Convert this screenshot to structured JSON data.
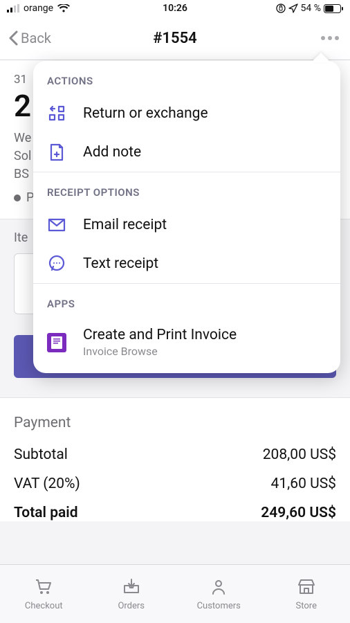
{
  "status_bar": {
    "carrier": "orange",
    "time": "10:26",
    "battery_pct": "54 %"
  },
  "nav": {
    "back_label": "Back",
    "title": "#1554"
  },
  "order": {
    "date": "31",
    "amount_prefix": "2",
    "addr1": "We",
    "addr2": "Sol",
    "addr3": "BS",
    "status_label": "P"
  },
  "items": {
    "label": "Ite"
  },
  "return_button": "Return or exchange",
  "payment": {
    "title": "Payment",
    "rows": [
      {
        "label": "Subtotal",
        "value": "208,00 US$"
      },
      {
        "label": "VAT (20%)",
        "value": "41,60 US$"
      },
      {
        "label": "Total paid",
        "value": "249,60 US$"
      }
    ]
  },
  "tabs": [
    {
      "label": "Checkout"
    },
    {
      "label": "Orders"
    },
    {
      "label": "Customers"
    },
    {
      "label": "Store"
    }
  ],
  "popover": {
    "section_actions": "ACTIONS",
    "action_return": "Return or exchange",
    "action_note": "Add note",
    "section_receipt": "RECEIPT OPTIONS",
    "receipt_email": "Email receipt",
    "receipt_text": "Text receipt",
    "section_apps": "APPS",
    "app_title": "Create and Print Invoice",
    "app_sub": "Invoice Browse"
  }
}
